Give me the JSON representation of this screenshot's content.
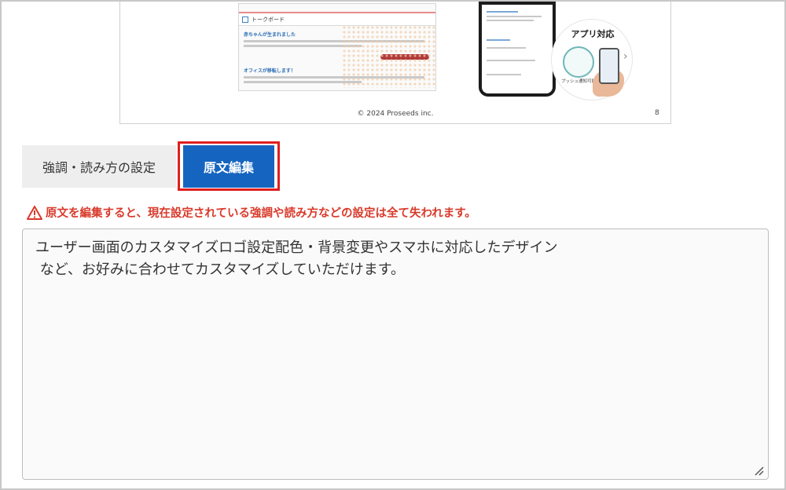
{
  "slide": {
    "board_title": "トークボード",
    "post1_title": "赤ちゃんが生まれました",
    "post2_title": "オフィスが移転します！",
    "badge_title": "アプリ対応",
    "badge_label": "プッシュ通知可能",
    "copyright": "© 2024 Proseeds inc.",
    "page_number": "8"
  },
  "tabs": {
    "emphasis_label": "強調・読み方の設定",
    "edit_label": "原文編集"
  },
  "warning": {
    "text": "原文を編集すると、現在設定されている強調や読み方などの設定は全て失われます。"
  },
  "editor": {
    "text": "ユーザー画面のカスタマイズロゴ設定配色・背景変更やスマホに対応したデザイン\n など、お好みに合わせてカスタマイズしていただけます。"
  },
  "colors": {
    "accent": "#1565c0",
    "highlight": "#e01e1e",
    "warning": "#d93a2b"
  }
}
